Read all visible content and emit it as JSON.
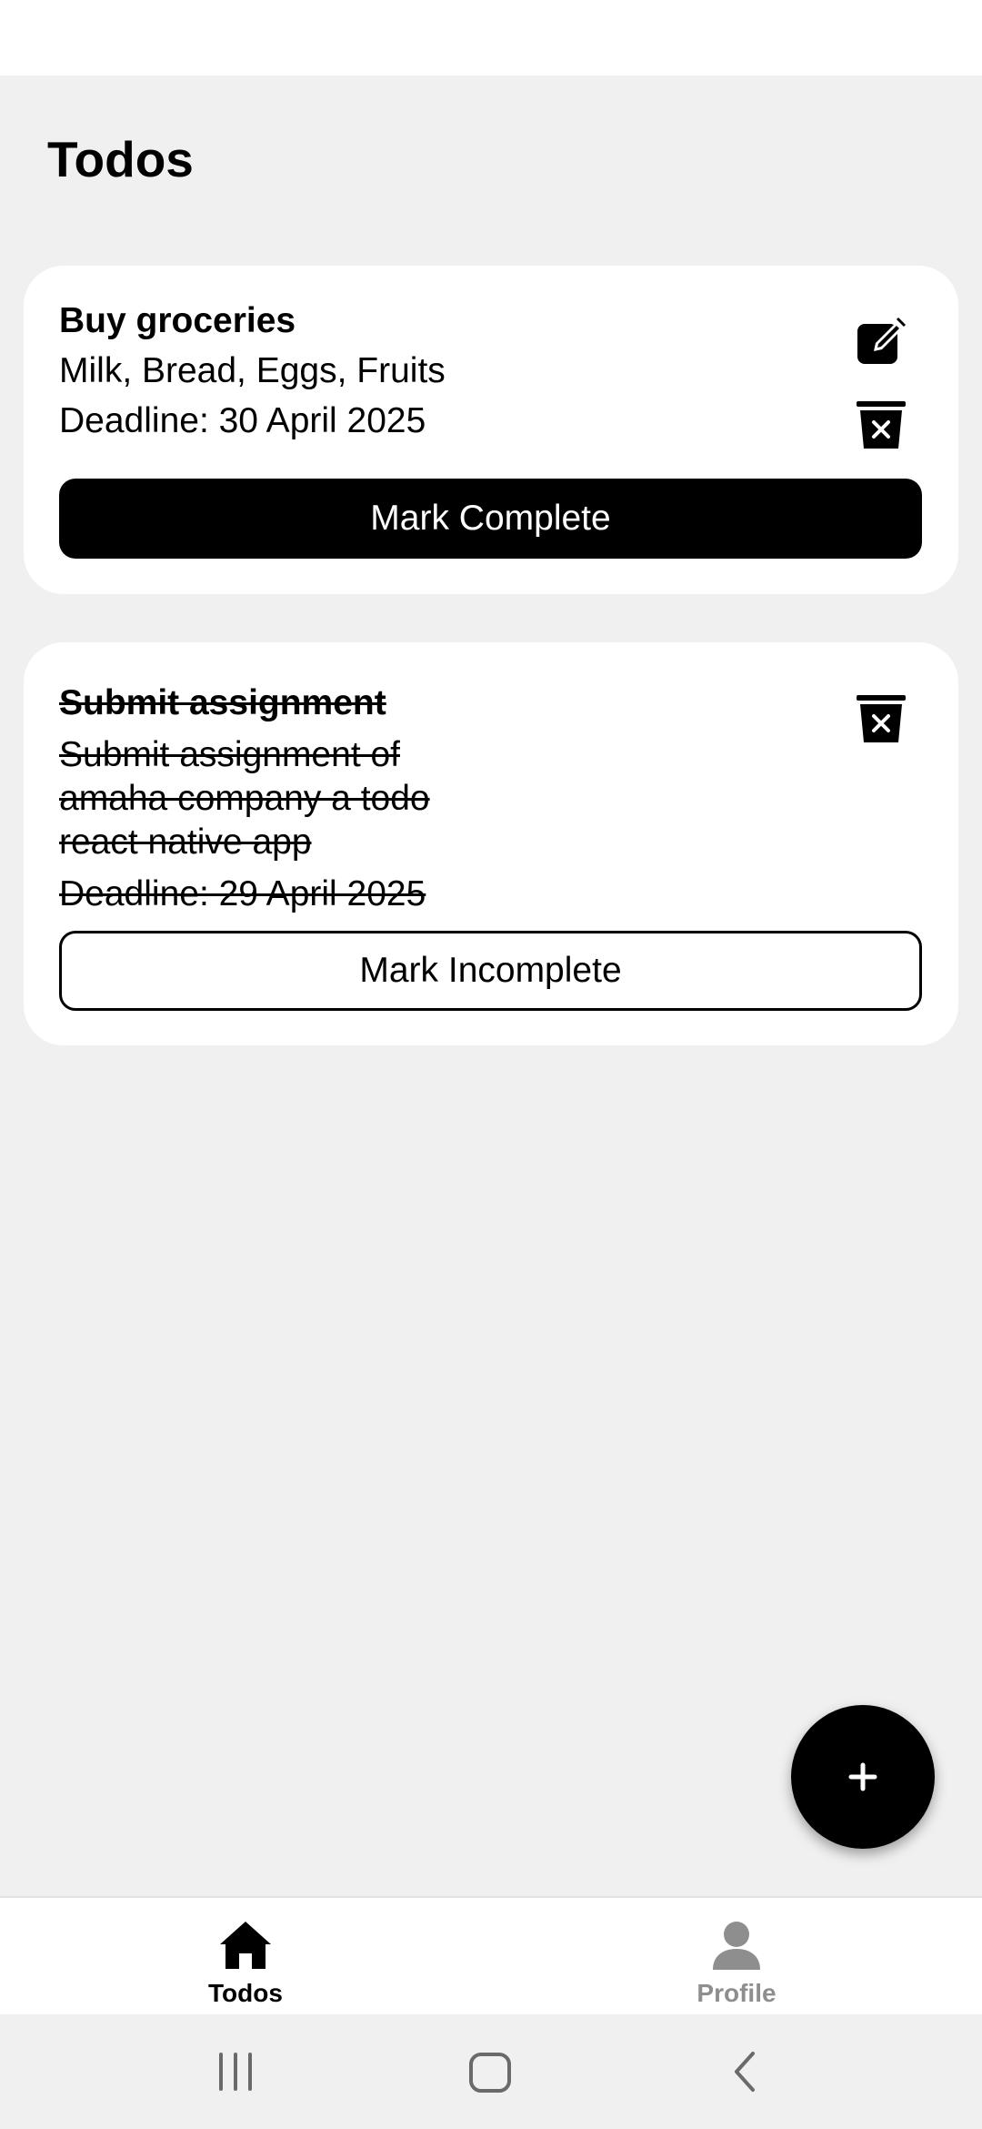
{
  "page": {
    "title": "Todos"
  },
  "todos": [
    {
      "title": "Buy groceries",
      "description": "Milk, Bread, Eggs, Fruits",
      "deadline": "Deadline: 30 April 2025",
      "completed": false,
      "action_label": "Mark Complete",
      "icons": [
        "edit-icon",
        "delete-icon"
      ]
    },
    {
      "title": "Submit assignment ",
      "description": "Submit assignment of amaha company a todo react native app",
      "deadline": "Deadline: 29 April 2025",
      "completed": true,
      "action_label": "Mark Incomplete",
      "icons": [
        "delete-icon"
      ]
    }
  ],
  "fab": {
    "icon": "plus-icon"
  },
  "bottom_nav": {
    "items": [
      {
        "label": "Todos",
        "icon": "home-icon",
        "active": true
      },
      {
        "label": "Profile",
        "icon": "person-icon",
        "active": false
      }
    ]
  },
  "system_nav": {
    "icons": [
      "recents-icon",
      "home-square-icon",
      "back-icon"
    ]
  },
  "colors": {
    "background": "#f0f0f0",
    "card": "#ffffff",
    "primary": "#000000",
    "inactive": "#8e8e8e"
  }
}
